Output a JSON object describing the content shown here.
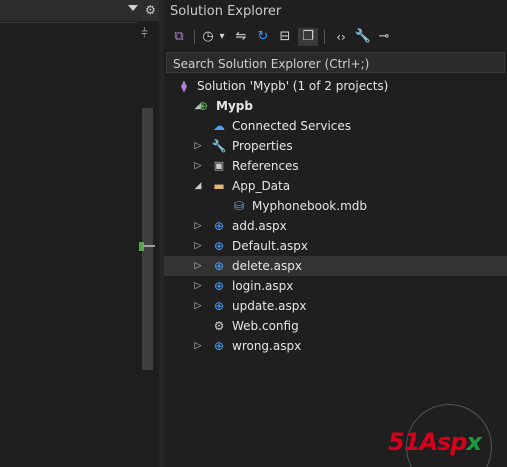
{
  "solution_explorer": {
    "title": "Solution Explorer",
    "search_placeholder": "Search Solution Explorer (Ctrl+;)",
    "toolbar": [
      {
        "name": "switch-views-icon",
        "glyph": "⧉"
      },
      {
        "name": "history-icon",
        "glyph": "◷"
      },
      {
        "name": "history-dropdown-icon",
        "glyph": "▾"
      },
      {
        "name": "sync-icon",
        "glyph": "⇋"
      },
      {
        "name": "refresh-icon",
        "glyph": "↻"
      },
      {
        "name": "collapse-all-icon",
        "glyph": "⊟"
      },
      {
        "name": "show-all-files-icon",
        "glyph": "❐"
      },
      {
        "name": "code-view-icon",
        "glyph": "‹›"
      },
      {
        "name": "properties-icon",
        "glyph": "🔧"
      },
      {
        "name": "preview-icon",
        "glyph": "⊸"
      }
    ],
    "tree": [
      {
        "label": "Solution 'Mypb' (1 of 2 projects)",
        "icon": "solution-icon",
        "glyph": "⧫",
        "depth": 0,
        "expander": "",
        "bold": false
      },
      {
        "label": "Mypb",
        "icon": "project-icon",
        "glyph": "⊕",
        "depth": 1,
        "expander": "◢",
        "bold": true
      },
      {
        "label": "Connected Services",
        "icon": "connected-services-icon",
        "glyph": "☁",
        "depth": 2,
        "expander": "",
        "bold": false
      },
      {
        "label": "Properties",
        "icon": "wrench-icon",
        "glyph": "🔧",
        "depth": 2,
        "expander": "▷",
        "bold": false
      },
      {
        "label": "References",
        "icon": "references-icon",
        "glyph": "▣",
        "depth": 2,
        "expander": "▷",
        "bold": false
      },
      {
        "label": "App_Data",
        "icon": "folder-icon",
        "glyph": "▬",
        "depth": 2,
        "expander": "◢",
        "bold": false
      },
      {
        "label": "Myphonebook.mdb",
        "icon": "database-icon",
        "glyph": "⛁",
        "depth": 3,
        "expander": "",
        "bold": false
      },
      {
        "label": "add.aspx",
        "icon": "web-page-icon",
        "glyph": "⊕",
        "depth": 2,
        "expander": "▷",
        "bold": false
      },
      {
        "label": "Default.aspx",
        "icon": "web-page-icon",
        "glyph": "⊕",
        "depth": 2,
        "expander": "▷",
        "bold": false
      },
      {
        "label": "delete.aspx",
        "icon": "web-page-icon",
        "glyph": "⊕",
        "depth": 2,
        "expander": "▷",
        "bold": false
      },
      {
        "label": "login.aspx",
        "icon": "web-page-icon",
        "glyph": "⊕",
        "depth": 2,
        "expander": "▷",
        "bold": false
      },
      {
        "label": "update.aspx",
        "icon": "web-page-icon",
        "glyph": "⊕",
        "depth": 2,
        "expander": "▷",
        "bold": false
      },
      {
        "label": "Web.config",
        "icon": "config-gear-icon",
        "glyph": "⚙",
        "depth": 2,
        "expander": "",
        "bold": false
      },
      {
        "label": "wrong.aspx",
        "icon": "web-page-icon",
        "glyph": "⊕",
        "depth": 2,
        "expander": "▷",
        "bold": false
      }
    ],
    "highlighted_item": "delete.aspx"
  },
  "editor_strip": {
    "dropdown_icon": "chevron-down-icon",
    "settings_icon": "gear-icon",
    "split_icon": "split-editor-icon"
  },
  "watermark": {
    "brand_main": "51Asp",
    "brand_tail": "x"
  },
  "colors": {
    "background": "#1f1f1f",
    "accent_blue": "#3794ff",
    "highlight_row": "#333333",
    "watermark_red": "#d6001c",
    "watermark_green": "#1a9b3e"
  }
}
